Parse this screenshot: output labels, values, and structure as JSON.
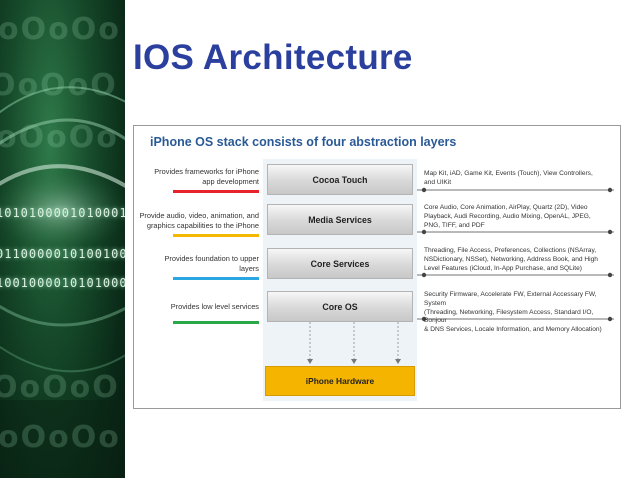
{
  "slide": {
    "title": "IOS Architecture"
  },
  "decor": {
    "binary_lines": [
      "1010100001010001",
      "0110000010100100",
      "1001000010101000"
    ]
  },
  "diagram": {
    "heading": "iPhone OS stack consists of four abstraction layers",
    "layers": [
      {
        "name": "Cocoa Touch",
        "left_text": "Provides frameworks for iPhone\napp development",
        "underline_color": "#e8222a",
        "right_text": "Map Kit, iAD, Game Kit, Events (Touch), View Controllers,\nand UIKit"
      },
      {
        "name": "Media Services",
        "left_text": "Provide audio, video, animation, and\ngraphics capabilities to the iPhone",
        "underline_color": "#f5b800",
        "right_text": "Core Audio, Core Animation, AirPlay, Quartz (2D), Video\nPlayback, Audi Recording, Audio Mixing, OpenAL, JPEG,\nPNG, TIFF, and PDF"
      },
      {
        "name": "Core Services",
        "left_text": "Provides foundation to upper\nlayers",
        "underline_color": "#2aa6e0",
        "right_text": "Threading, File Access, Preferences, Collections (NSArray,\nNSDictionary, NSSet), Networking, Address Book, and High\nLevel Features (iCloud, In-App Purchase, and SQLite)"
      },
      {
        "name": "Core OS",
        "left_text": "Provides low level services",
        "underline_color": "#2aa84a",
        "right_text": "Security Firmware, Accelerate FW, External Accessary FW, System\n(Threading, Networking, Filesystem Access, Standard I/O, Bonjour\n& DNS Services, Locale Information, and Memory Allocation)"
      }
    ],
    "hardware": "iPhone Hardware"
  }
}
